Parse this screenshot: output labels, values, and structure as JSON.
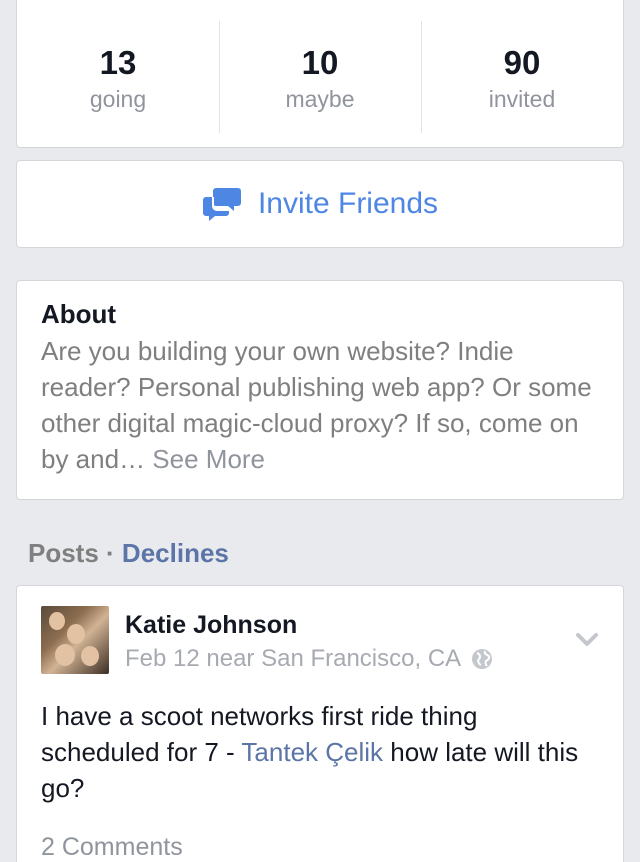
{
  "stats": [
    {
      "count": "13",
      "label": "going"
    },
    {
      "count": "10",
      "label": "maybe"
    },
    {
      "count": "90",
      "label": "invited"
    }
  ],
  "invite": {
    "label": "Invite Friends",
    "icon": "chat-bubbles-icon"
  },
  "about": {
    "title": "About",
    "text": "Are you building your own website? Indie reader? Personal publishing web app? Or some other digital magic-cloud proxy? If so, come on by and… ",
    "see_more": "See More"
  },
  "posts_header": {
    "label": "Posts",
    "separator": " · ",
    "link": "Declines"
  },
  "post": {
    "author": "Katie Johnson",
    "meta": "Feb 12 near San Francisco, CA",
    "text_before": "I have a scoot networks first ride thing scheduled for 7 - ",
    "mention": "Tantek Çelik",
    "text_after": " how late will this go?",
    "comments": "2 Comments"
  },
  "colors": {
    "background": "#e9eaed",
    "accent": "#4e86e4",
    "link": "#5b75a8",
    "muted": "#90949c"
  }
}
